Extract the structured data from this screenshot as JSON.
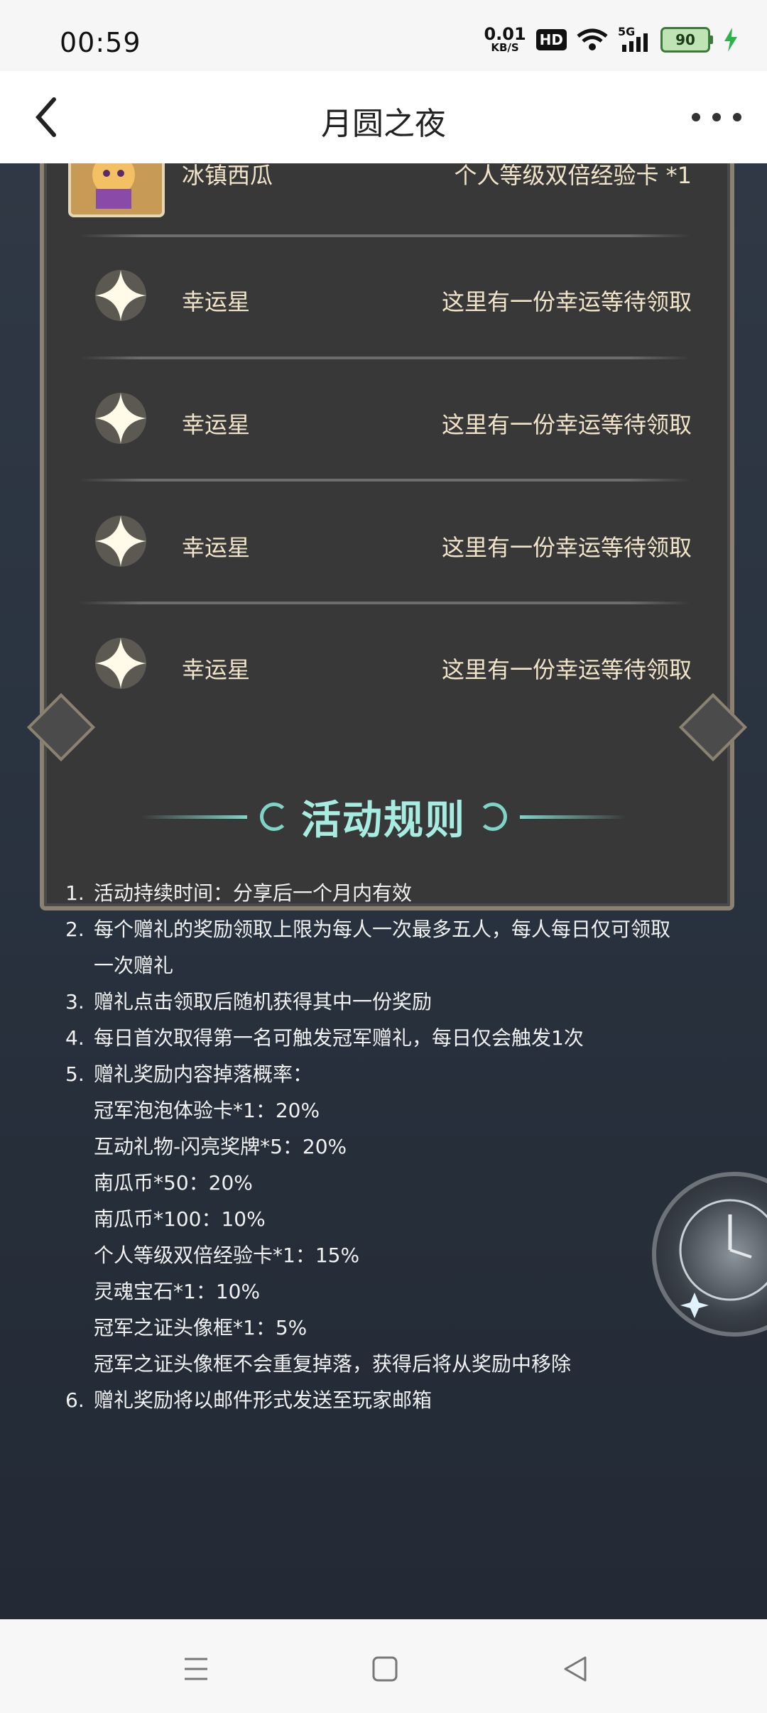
{
  "status_bar": {
    "time": "00:59",
    "net_speed_value": "0.01",
    "net_speed_unit": "KB/S",
    "hd": "HD",
    "signal": "5G",
    "battery": "90",
    "icons": [
      "wifi-icon",
      "signal-icon",
      "battery-icon",
      "charging-icon"
    ]
  },
  "header": {
    "title": "月圆之夜",
    "back_icon": "back-arrow-icon",
    "more_icon": "more-dots-icon"
  },
  "rewards": [
    {
      "name": "冰镇西瓜",
      "desc": "个人等级双倍经验卡 *1",
      "icon": "avatar"
    },
    {
      "name": "幸运星",
      "desc": "这里有一份幸运等待领取",
      "icon": "sparkle-star-icon"
    },
    {
      "name": "幸运星",
      "desc": "这里有一份幸运等待领取",
      "icon": "sparkle-star-icon"
    },
    {
      "name": "幸运星",
      "desc": "这里有一份幸运等待领取",
      "icon": "sparkle-star-icon"
    },
    {
      "name": "幸运星",
      "desc": "这里有一份幸运等待领取",
      "icon": "sparkle-star-icon"
    }
  ],
  "rules": {
    "title": "活动规则",
    "items": [
      {
        "num": "1.",
        "text": "活动持续时间：分享后一个月内有效"
      },
      {
        "num": "2.",
        "text": "每个赠礼的奖励领取上限为每人一次最多五人，每人每日仅可领取"
      },
      {
        "num": "",
        "text": "一次赠礼"
      },
      {
        "num": "3.",
        "text": "赠礼点击领取后随机获得其中一份奖励"
      },
      {
        "num": "4.",
        "text": "每日首次取得第一名可触发冠军赠礼，每日仅会触发1次"
      },
      {
        "num": "5.",
        "text": "赠礼奖励内容掉落概率："
      },
      {
        "num": "",
        "text": "冠军泡泡体验卡*1：20%"
      },
      {
        "num": "",
        "text": "互动礼物-闪亮奖牌*5：20%"
      },
      {
        "num": "",
        "text": "南瓜币*50：20%"
      },
      {
        "num": "",
        "text": "南瓜币*100：10%"
      },
      {
        "num": "",
        "text": "个人等级双倍经验卡*1：15%"
      },
      {
        "num": "",
        "text": "灵魂宝石*1：10%"
      },
      {
        "num": "",
        "text": "冠军之证头像框*1：5%"
      },
      {
        "num": "",
        "text": "冠军之证头像框不会重复掉落，获得后将从奖励中移除"
      },
      {
        "num": "6.",
        "text": "赠礼奖励将以邮件形式发送至玩家邮箱"
      }
    ]
  },
  "nav": {
    "icons": [
      "menu-icon",
      "home-square-icon",
      "back-triangle-icon"
    ]
  },
  "colors": {
    "background": "#2b3340",
    "panel": "#383838",
    "gold_text": "#f1e4c8",
    "rules_title": "#a6ece0"
  }
}
